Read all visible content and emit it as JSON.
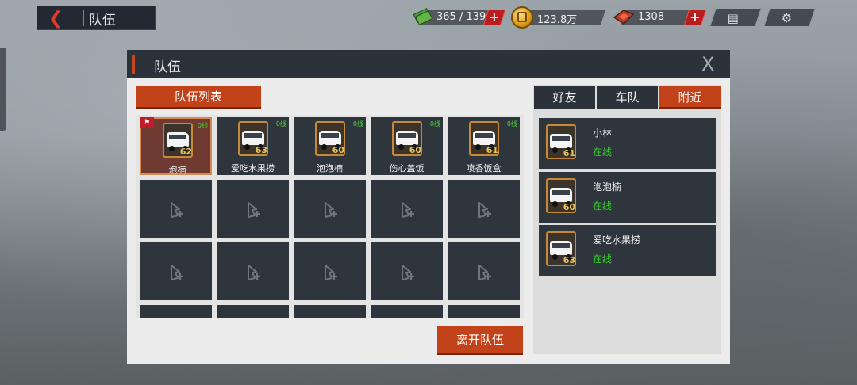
{
  "topbar": {
    "back_title": "队伍",
    "fuel_value": "365 / 139",
    "gold_value": "123.8万",
    "gem_value": "1308",
    "plus_label": "+"
  },
  "dialog": {
    "title": "队伍",
    "close_label": "X",
    "list_tab_label": "队伍列表",
    "leave_button_label": "离开队伍"
  },
  "team": {
    "members": [
      {
        "name": "泡楠",
        "level": "62",
        "status": "0线",
        "is_leader": true
      },
      {
        "name": "爱吃水果捞",
        "level": "63",
        "status": "0线",
        "is_leader": false
      },
      {
        "name": "泡泡楠",
        "level": "60",
        "status": "0线",
        "is_leader": false
      },
      {
        "name": "伤心盖饭",
        "level": "60",
        "status": "0线",
        "is_leader": false
      },
      {
        "name": "喷香饭盒",
        "level": "61",
        "status": "0线",
        "is_leader": false
      }
    ],
    "leader_flag": "⚑"
  },
  "right": {
    "tabs": [
      {
        "label": "好友",
        "active": false
      },
      {
        "label": "车队",
        "active": false
      },
      {
        "label": "附近",
        "active": true
      }
    ],
    "friends": [
      {
        "name": "小林",
        "status": "在线",
        "level": "61"
      },
      {
        "name": "泡泡楠",
        "status": "在线",
        "level": "60"
      },
      {
        "name": "爱吃水果捞",
        "status": "在线",
        "level": "63"
      }
    ]
  },
  "icons": {
    "back": "back-arrow-icon",
    "fuel": "money-stack-icon",
    "gold": "gold-coin-icon",
    "gem": "ticket-icon",
    "shop": "shop-icon",
    "settings": "gear-icon",
    "add_member": "add-member-icon"
  },
  "colors": {
    "accent": "#c24219",
    "online": "#36c92a",
    "panel_dark": "#2f353d"
  }
}
